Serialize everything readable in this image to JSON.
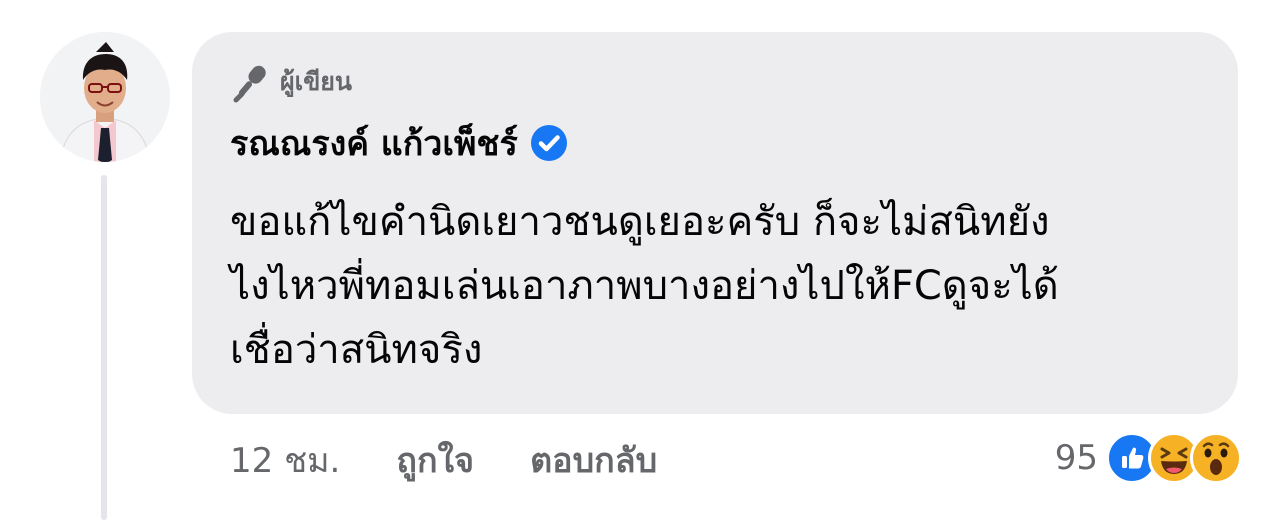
{
  "comment": {
    "badge": {
      "icon": "microphone-icon",
      "label": "ผู้เขียน"
    },
    "author": {
      "name": "รณณรงค์ แก้วเพ็ชร์",
      "verified_icon": "verified-check-icon",
      "avatar_icon": "profile-avatar"
    },
    "text_lines": [
      "ขอแก้ไขคำนิดเยาวชนดูเยอะครับ ก็จะไม่สนิทยัง",
      "ไงไหวพี่ทอมเล่นเอาภาพบางอย่างไปให้FCดูจะได้",
      "เชื่อว่าสนิทจริง"
    ]
  },
  "actions": {
    "time": "12 ชม.",
    "like_label": "ถูกใจ",
    "reply_label": "ตอบกลับ"
  },
  "reactions": {
    "count": "95",
    "icons": [
      "like-reaction-icon",
      "haha-reaction-icon",
      "wow-reaction-icon"
    ]
  },
  "colors": {
    "bubble_bg": "#ededf0",
    "secondary_text": "#65676b",
    "primary_text": "#050505",
    "accent_blue": "#1877f2",
    "reaction_yellow": "#f7b125"
  }
}
